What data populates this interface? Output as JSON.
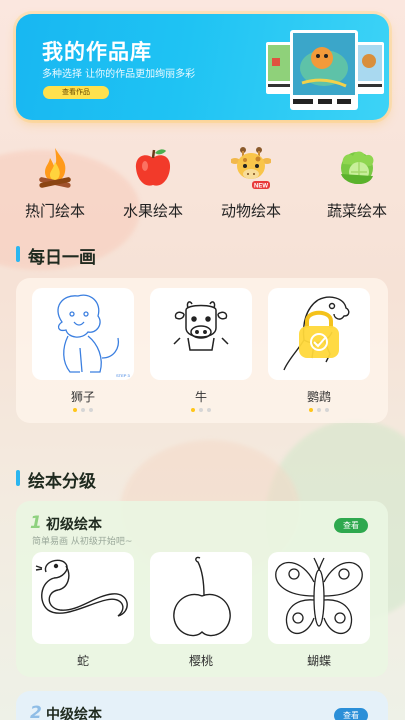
{
  "banner": {
    "title": "我的作品库",
    "subtitle": "多种选择 让你的作品更加绚丽多彩",
    "button_label": "查看作品"
  },
  "categories": [
    {
      "label": "热门绘本",
      "icon": "campfire-icon"
    },
    {
      "label": "水果绘本",
      "icon": "apple-icon"
    },
    {
      "label": "动物绘本",
      "icon": "giraffe-icon",
      "badge": "NEW"
    },
    {
      "label": "蔬菜绘本",
      "icon": "cabbage-icon"
    }
  ],
  "daily": {
    "title": "每日一画",
    "items": [
      {
        "name": "狮子",
        "icon": "lion-drawing-icon"
      },
      {
        "name": "牛",
        "icon": "cow-drawing-icon"
      },
      {
        "name": "鹦鹉",
        "icon": "parrot-drawing-icon",
        "locked": true
      }
    ]
  },
  "levels": {
    "title": "绘本分级",
    "beginner": {
      "number": "1",
      "title": "初级绘本",
      "subtitle": "简单易画 从初级开始吧~",
      "button_label": "查看",
      "items": [
        {
          "name": "蛇",
          "icon": "snake-drawing-icon"
        },
        {
          "name": "樱桃",
          "icon": "cherry-drawing-icon"
        },
        {
          "name": "蝴蝶",
          "icon": "butterfly-drawing-icon"
        }
      ]
    },
    "intermediate": {
      "number": "2",
      "title": "中级绘本",
      "button_label": "查看"
    }
  },
  "colors": {
    "banner": "#1fc3f3",
    "accent_bar": "#2bb6f0",
    "see_button": "#2ea84e",
    "dot_active": "#ffc61a"
  }
}
